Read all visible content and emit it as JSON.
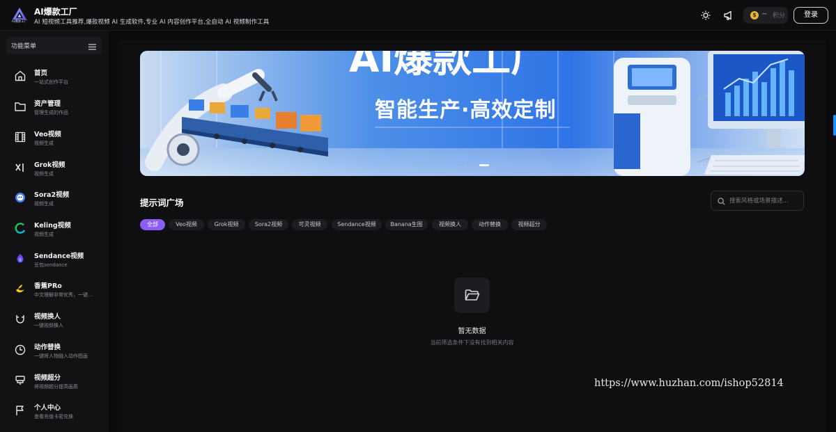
{
  "header": {
    "app_title": "AI爆款工厂",
    "app_subtitle": "AI 短视频工具推荐,爆款视频 AI 生成软件,专业 AI 内容创作平台,全自动 AI 视频制作工具",
    "logo_text": "AI爆款工厂",
    "points_value": "--",
    "points_label": "积分",
    "login_label": "登录",
    "icons": [
      "sun-icon",
      "megaphone-icon",
      "coin-icon"
    ]
  },
  "sidebar": {
    "menu_title": "功能菜单",
    "items": [
      {
        "label": "首页",
        "desc": "一站式创作平台",
        "icon": "home-icon"
      },
      {
        "label": "资产管理",
        "desc": "管理生成的作品",
        "icon": "folder-icon"
      },
      {
        "label": "Veo视频",
        "desc": "视频生成",
        "icon": "film-icon"
      },
      {
        "label": "Grok视频",
        "desc": "视频生成",
        "icon": "grok-icon"
      },
      {
        "label": "Sora2视频",
        "desc": "视频生成",
        "icon": "sora-icon"
      },
      {
        "label": "Keling视频",
        "desc": "视频生成",
        "icon": "keling-icon"
      },
      {
        "label": "Sendance视频",
        "desc": "豆包sendance",
        "icon": "sendance-icon"
      },
      {
        "label": "香蕉PRo",
        "desc": "中文理解非常优秀，一键...",
        "icon": "banana-icon"
      },
      {
        "label": "视频换人",
        "desc": "一键视频换人",
        "icon": "magnet-icon"
      },
      {
        "label": "动作替换",
        "desc": "一键将人物融入动作图画",
        "icon": "clock-icon"
      },
      {
        "label": "视频超分",
        "desc": "将视频超分提高画质",
        "icon": "brush-icon"
      },
      {
        "label": "个人中心",
        "desc": "查看充值卡密兑换",
        "icon": "flag-icon"
      }
    ]
  },
  "banner": {
    "headline": "AI爆款工厂",
    "tagline": "智能生产·高效定制",
    "slide_count": 3,
    "active_slide": 3
  },
  "prompts": {
    "title": "提示词广场",
    "search_placeholder": "搜索风格或场景描述...",
    "filters": [
      "全部",
      "Veo视频",
      "Grok视频",
      "Sora2视频",
      "可灵视频",
      "Sendance视频",
      "Banana生图",
      "视频换人",
      "动作替换",
      "视频超分"
    ],
    "active_filter": "全部"
  },
  "empty_state": {
    "title": "暂无数据",
    "desc": "当前筛选条件下没有找到相关内容",
    "icon": "folder-open-icon"
  },
  "watermark": "https://www.huzhan.com/ishop52814",
  "colors": {
    "accent": "#8b5cf6",
    "background": "#0b0b0d",
    "sidebar": "#121215",
    "coin": "#e8b53a"
  }
}
